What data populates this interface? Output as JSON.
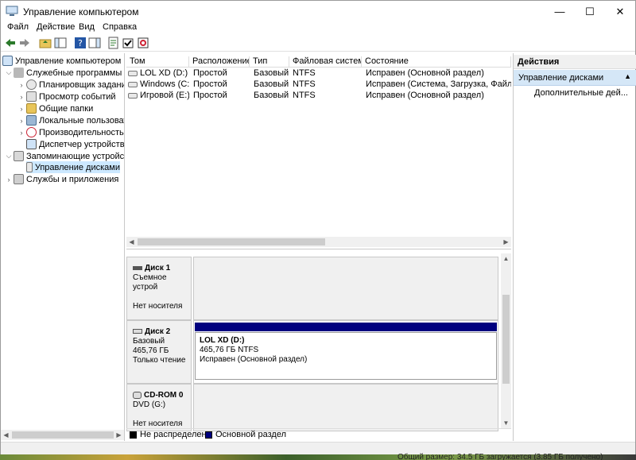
{
  "window": {
    "title": "Управление компьютером",
    "controls": {
      "minimize": "—",
      "maximize": "☐",
      "close": "✕"
    }
  },
  "menu": [
    "Файл",
    "Действие",
    "Вид",
    "Справка"
  ],
  "tree": {
    "root": "Управление компьютером (л",
    "items": [
      {
        "label": "Служебные программы"
      },
      {
        "label": "Планировщик заданий"
      },
      {
        "label": "Просмотр событий"
      },
      {
        "label": "Общие папки"
      },
      {
        "label": "Локальные пользовате"
      },
      {
        "label": "Производительность"
      },
      {
        "label": "Диспетчер устройств"
      },
      {
        "label": "Запоминающие устройств"
      },
      {
        "label": "Управление дисками"
      },
      {
        "label": "Службы и приложения"
      }
    ]
  },
  "volumes": {
    "columns": [
      "Том",
      "Расположение",
      "Тип",
      "Файловая система",
      "Состояние"
    ],
    "rows": [
      {
        "name": "LOL XD (D:)",
        "layout": "Простой",
        "type": "Базовый",
        "fs": "NTFS",
        "status": "Исправен (Основной раздел)"
      },
      {
        "name": "Windows (C:)",
        "layout": "Простой",
        "type": "Базовый",
        "fs": "NTFS",
        "status": "Исправен (Система, Загрузка, Файл подк"
      },
      {
        "name": "Игровой (E:)",
        "layout": "Простой",
        "type": "Базовый",
        "fs": "NTFS",
        "status": "Исправен (Основной раздел)"
      }
    ]
  },
  "disks": [
    {
      "name": "Диск 1",
      "line1": "Съемное устрой",
      "line2": "",
      "line3": "Нет носителя"
    },
    {
      "name": "Диск 2",
      "line1": "Базовый",
      "line2": "465,76 ГБ",
      "line3": "Только чтение",
      "partition": {
        "label": "LOL XD  (D:)",
        "size": "465,76 ГБ NTFS",
        "status": "Исправен (Основной раздел)"
      }
    },
    {
      "name": "CD-ROM 0",
      "line1": "DVD (G:)",
      "line2": "",
      "line3": "Нет носителя"
    }
  ],
  "legend": {
    "unallocated": "Не распределена",
    "primary": "Основной раздел"
  },
  "actions": {
    "header": "Действия",
    "section": "Управление дисками",
    "more": "Дополнительные дей..."
  },
  "background_text": "Общий размер: 34.5 ГБ загружается (3.85 ГБ получено)",
  "colors": {
    "primary_partition": "#00007f",
    "selection": "#cce8ff",
    "actions_section": "#d5e7f7"
  }
}
